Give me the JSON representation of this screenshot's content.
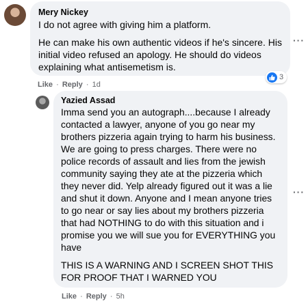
{
  "comments": [
    {
      "author": "Mery Nickey",
      "paragraphs": [
        "I do not agree with giving him a platform.",
        "He can make his own authentic videos if he's sincere. His initial video refused an apology. He should do videos explaining what antisemetism is."
      ],
      "actions": {
        "like": "Like",
        "reply": "Reply",
        "time": "1d",
        "separator": "·"
      },
      "reactions": {
        "icon": "like-icon",
        "count": "3",
        "color": "#1877f2"
      },
      "more_icon": "more-options-icon"
    },
    {
      "author": "Yazied Assad",
      "paragraphs": [
        "Imma send you an autograph....because I already contacted a lawyer, anyone of you go near my brothers pizzeria again trying to harm his business. We are going to press charges. There were no police records of assault and lies from the jewish community saying they ate at the pizzeria which they never did. Yelp already figured out it was a lie and shut it down. Anyone and I mean anyone tries to go near or say lies about my brothers pizzeria that had NOTHING to do with this situation and i promise you we will sue you for EVERYTHING you have",
        "THIS IS A WARNING AND I SCREEN SHOT THIS FOR PROOF THAT I WARNED YOU"
      ],
      "actions": {
        "like": "Like",
        "reply": "Reply",
        "time": "5h",
        "separator": "·"
      },
      "more_icon": "more-options-icon"
    }
  ],
  "colors": {
    "bubble": "#f0f2f5",
    "secondary_text": "#65676b",
    "primary_text": "#050505"
  }
}
